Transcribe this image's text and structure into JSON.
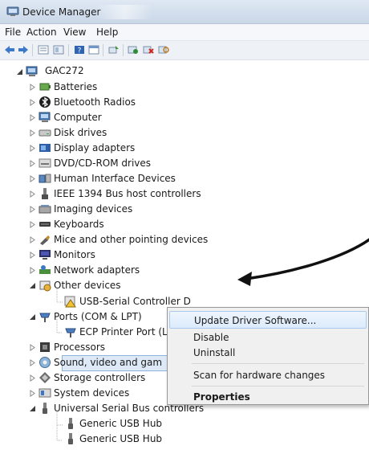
{
  "window": {
    "title": "Device Manager"
  },
  "menubar": {
    "items": [
      "File",
      "Action",
      "View",
      "Help"
    ]
  },
  "tree": {
    "root": "GAC272",
    "categories": [
      "Batteries",
      "Bluetooth Radios",
      "Computer",
      "Disk drives",
      "Display adapters",
      "DVD/CD-ROM drives",
      "Human Interface Devices",
      "IEEE 1394 Bus host controllers",
      "Imaging devices",
      "Keyboards",
      "Mice and other pointing devices",
      "Monitors",
      "Network adapters",
      "Other devices",
      "USB-Serial Controller D",
      "Ports (COM & LPT)",
      "ECP Printer Port (LP",
      "Processors",
      "Sound, video and gam",
      "Storage controllers",
      "System devices",
      "Universal Serial Bus controllers",
      "Generic USB Hub",
      "Generic USB Hub"
    ]
  },
  "context_menu": {
    "items": [
      "Update Driver Software...",
      "Disable",
      "Uninstall",
      "Scan for hardware changes",
      "Properties"
    ]
  },
  "colors": {
    "selection": "#dde9f6",
    "menu_hover": "#dcebfc",
    "accent": "#3c78c8"
  }
}
